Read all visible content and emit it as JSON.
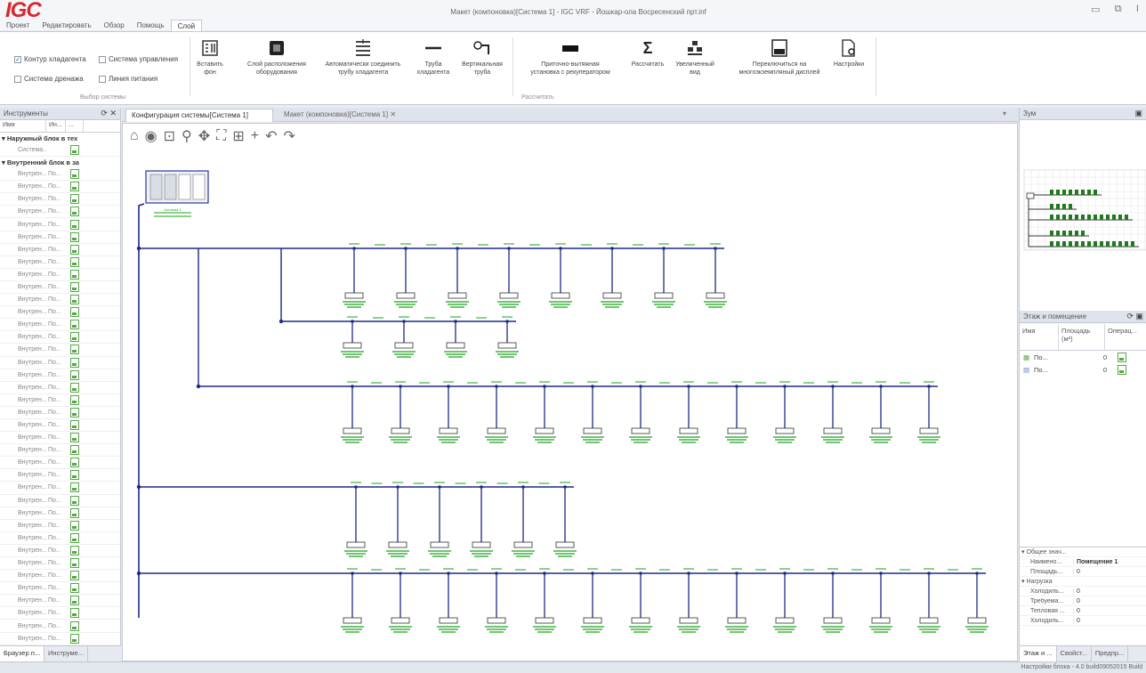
{
  "app": {
    "logo": "IGC",
    "window_title": "Макет (компоновка)[Система 1] - IGC VRF - Йошкар-ола Восресенский прт.inf",
    "menu_tabs": [
      "Проект",
      "Редактировать",
      "Обзор",
      "Помощь",
      "Слой"
    ]
  },
  "ribbon": {
    "checkboxes": [
      {
        "label": "Контур хладагента",
        "checked": true
      },
      {
        "label": "Система управления",
        "checked": false
      },
      {
        "label": "Система дренажа",
        "checked": false
      },
      {
        "label": "Линия питания",
        "checked": false
      }
    ],
    "group_system": "Выбор системы",
    "group_calc": "Рассчитать",
    "buttons": [
      {
        "icon": "insert-background-icon",
        "line1": "Вставить",
        "line2": "фон"
      },
      {
        "icon": "equipment-layer-icon",
        "line1": "Слой расположения",
        "line2": "оборудования"
      },
      {
        "icon": "auto-connect-icon",
        "line1": "Автоматически соединить",
        "line2": "трубу хладагента"
      },
      {
        "icon": "pipe-icon",
        "line1": "Труба",
        "line2": "хладагента"
      },
      {
        "icon": "vertical-pipe-icon",
        "line1": "Вертикальная",
        "line2": "труба"
      },
      {
        "icon": "ventilation-unit-icon",
        "line1": "Приточно-вытяжная",
        "line2": "установка с рекуператором"
      },
      {
        "icon": "sum-icon",
        "line1": "Рассчитать",
        "line2": ""
      },
      {
        "icon": "enlarged-view-icon",
        "line1": "Увеличенный",
        "line2": "вид"
      },
      {
        "icon": "multi-display-icon",
        "line1": "Переключиться на",
        "line2": "многоэкземпляный дисплей"
      },
      {
        "icon": "settings-icon",
        "line1": "Настройки",
        "line2": ""
      }
    ]
  },
  "left_panel": {
    "title": "Инструменты",
    "col_name": "Имя",
    "col_model": "Ин...",
    "col_extra": "...",
    "group_outdoor": "Наружный блок в тех",
    "outdoor_item": "Система...",
    "group_indoor": "Внутренний блок в за",
    "indoor_items": [
      [
        "Внутрен...",
        "По..."
      ],
      [
        "Внутрен...",
        "По..."
      ],
      [
        "Внутрен...",
        "По..."
      ],
      [
        "Внутрен...",
        "По..."
      ],
      [
        "Внутрен...",
        "По..."
      ],
      [
        "Внутрен...",
        "По..."
      ],
      [
        "Внутрен...",
        "По..."
      ],
      [
        "Внутрен...",
        "По..."
      ],
      [
        "Внутрен...",
        "По..."
      ],
      [
        "Внутрен...",
        "По..."
      ],
      [
        "Внутрен...",
        "По..."
      ],
      [
        "Внутрен...",
        "По..."
      ],
      [
        "Внутрен...",
        "По..."
      ],
      [
        "Внутрен...",
        "По..."
      ],
      [
        "Внутрен...",
        "По..."
      ],
      [
        "Внутрен...",
        "По..."
      ],
      [
        "Внутрен...",
        "По..."
      ],
      [
        "Внутрен...",
        "По..."
      ],
      [
        "Внутрен...",
        "По..."
      ],
      [
        "Внутрен...",
        "По..."
      ],
      [
        "Внутрен...",
        "По..."
      ],
      [
        "Внутрен...",
        "По..."
      ],
      [
        "Внутрен...",
        "По..."
      ],
      [
        "Внутрен...",
        "По..."
      ],
      [
        "Внутрен...",
        "По..."
      ],
      [
        "Внутрен...",
        "По..."
      ],
      [
        "Внутрен...",
        "По..."
      ],
      [
        "Внутрен...",
        "По..."
      ],
      [
        "Внутрен...",
        "По..."
      ],
      [
        "Внутрен...",
        "По..."
      ],
      [
        "Внутрен...",
        "По..."
      ],
      [
        "Внутрен...",
        "По..."
      ],
      [
        "Внутрен...",
        "По..."
      ],
      [
        "Внутрен...",
        "По..."
      ],
      [
        "Внутрен...",
        "По..."
      ],
      [
        "Внутрен...",
        "По..."
      ],
      [
        "Внутрен...",
        "По..."
      ],
      [
        "Внутрен...",
        "По..."
      ],
      [
        "Внутрен...",
        "По..."
      ],
      [
        "Внутрен...",
        "По..."
      ],
      [
        "Внутрен...",
        "По..."
      ]
    ],
    "bottom_tabs": [
      "Браузер п...",
      "Инструме..."
    ]
  },
  "doc_tabs": {
    "tab1": "Конфигурация системы[Система 1]",
    "tab2": "Макет (компоновка)[Система 1]"
  },
  "diagram": {
    "system_label": "Система 1",
    "branches": [
      {
        "units": 8
      },
      {
        "units": 4
      },
      {
        "units": 13
      },
      {
        "units": 6
      },
      {
        "units": 14
      }
    ]
  },
  "right_panel": {
    "zoom_title": "Зум",
    "rooms_title": "Этаж и помещение",
    "rooms_cols": [
      "Имя",
      "Площадь (м²)",
      "Операц..."
    ],
    "rooms": [
      {
        "name": "По...",
        "area": "0"
      },
      {
        "name": "По...",
        "area": "0"
      }
    ],
    "props": [
      {
        "k": "Общее знач...",
        "v": "",
        "group": true
      },
      {
        "k": "Наимено...",
        "v": "Помещение 1"
      },
      {
        "k": "Площадь...",
        "v": "0"
      },
      {
        "k": "Нагрузка",
        "v": "",
        "group": true
      },
      {
        "k": "Холодиль...",
        "v": "0"
      },
      {
        "k": "Требуема...",
        "v": "0"
      },
      {
        "k": "Тепловая ...",
        "v": "0"
      },
      {
        "k": "Холодиль...",
        "v": "0"
      }
    ],
    "bottom_tabs": [
      "Этаж и ...",
      "Свойст...",
      "Предпр..."
    ]
  },
  "status": "Настройки блока - 4.0 build09052015 Build"
}
